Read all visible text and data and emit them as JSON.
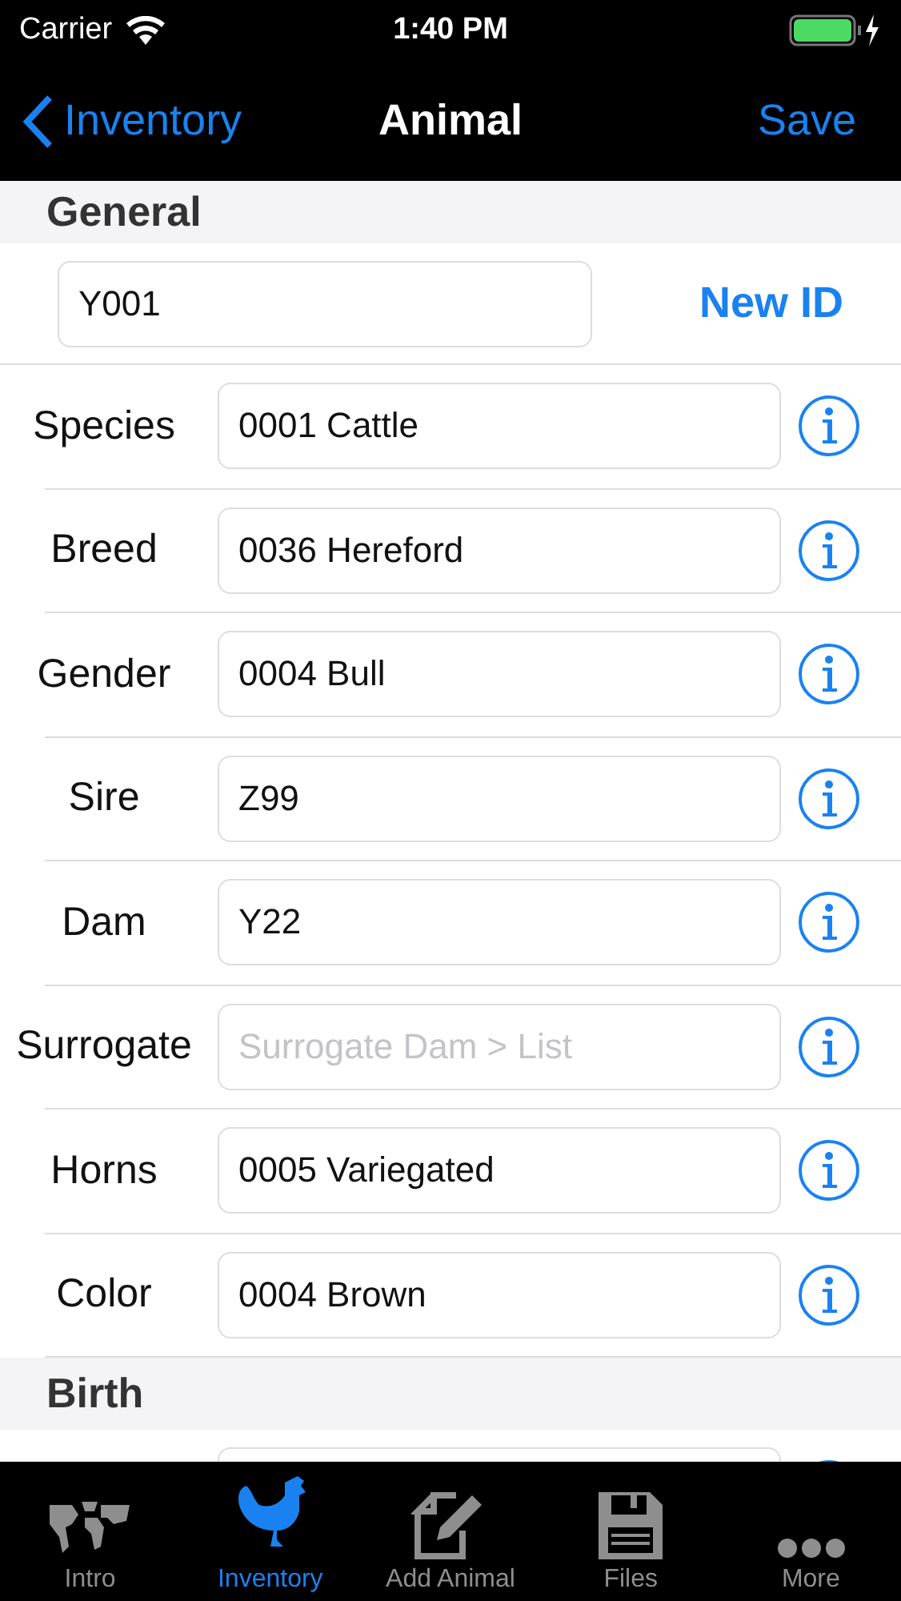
{
  "status_bar": {
    "carrier": "Carrier",
    "time": "1:40 PM"
  },
  "nav": {
    "back": "Inventory",
    "title": "Animal",
    "action": "Save"
  },
  "sections": [
    {
      "title": "General",
      "id_field": {
        "value": "Y001"
      },
      "id_button": "New ID",
      "rows": [
        {
          "label": "Species",
          "value": "0001 Cattle"
        },
        {
          "label": "Breed",
          "value": "0036 Hereford"
        },
        {
          "label": "Gender",
          "value": "0004 Bull"
        },
        {
          "label": "Sire",
          "value": "Z99"
        },
        {
          "label": "Dam",
          "value": "Y22"
        },
        {
          "label": "Surrogate",
          "placeholder": "Surrogate Dam > List"
        },
        {
          "label": "Horns",
          "value": "0005 Variegated"
        },
        {
          "label": "Color",
          "value": "0004 Brown"
        }
      ]
    },
    {
      "title": "Birth",
      "rows": [
        {
          "label": "",
          "value": ""
        }
      ]
    }
  ],
  "tabs": [
    {
      "label": "Intro",
      "kind": "map",
      "selected": false
    },
    {
      "label": "Inventory",
      "kind": "rooster",
      "selected": true
    },
    {
      "label": "Add Animal",
      "kind": "edit",
      "selected": false
    },
    {
      "label": "Files",
      "kind": "floppy",
      "selected": false
    },
    {
      "label": "More",
      "kind": "more",
      "selected": false
    }
  ]
}
